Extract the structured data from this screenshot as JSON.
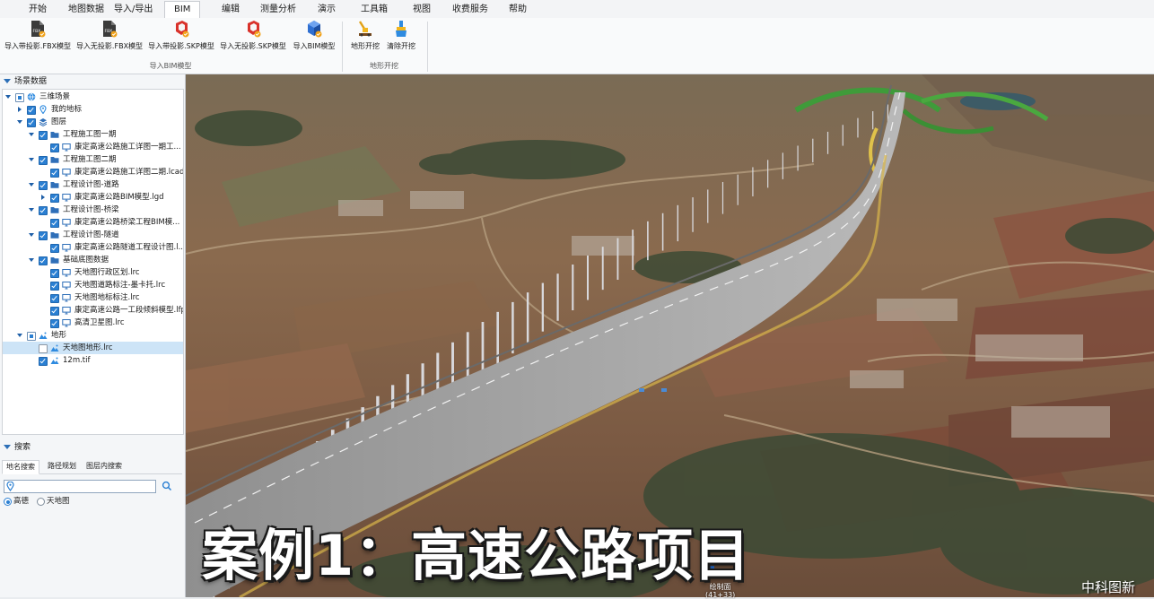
{
  "menu": {
    "items": [
      "开始",
      "地图数据",
      "导入/导出",
      "BIM",
      "编辑",
      "测量分析",
      "演示",
      "工具箱",
      "视图",
      "收费服务",
      "帮助"
    ],
    "active": "BIM"
  },
  "ribbon": {
    "bim_group_label": "导入BIM模型",
    "terrain_group_label": "地形开挖",
    "buttons": {
      "import_fbx_proj": "导入带投影.FBX模型",
      "import_fbx_noproj": "导入无投影.FBX模型",
      "import_skp_proj": "导入带投影.SKP模型",
      "import_skp_noproj": "导入无投影.SKP模型",
      "import_bim": "导入BIM模型",
      "terrain_dig": "地形开挖",
      "clear_dig": "清除开挖"
    },
    "icon_texts": {
      "fbx": "FBX"
    }
  },
  "scene_panel": {
    "title": "场景数据",
    "tree": [
      {
        "label": "三维场景",
        "depth": 0,
        "expanded": true,
        "check": "partial",
        "icon": "globe-icon"
      },
      {
        "label": "我的地标",
        "depth": 1,
        "expanded": false,
        "check": "on",
        "icon": "pin-icon"
      },
      {
        "label": "图层",
        "depth": 1,
        "expanded": true,
        "check": "on",
        "icon": "layers-icon"
      },
      {
        "label": "工程施工图一期",
        "depth": 2,
        "expanded": true,
        "check": "on",
        "icon": "folder-icon"
      },
      {
        "label": "康定高速公路施工详图一期工...",
        "depth": 3,
        "expanded": null,
        "check": "on",
        "icon": "monitor-icon"
      },
      {
        "label": "工程施工图二期",
        "depth": 2,
        "expanded": true,
        "check": "on",
        "icon": "folder-icon"
      },
      {
        "label": "康定高速公路施工详图二期.lcad",
        "depth": 3,
        "expanded": null,
        "check": "on",
        "icon": "monitor-icon"
      },
      {
        "label": "工程设计图-道路",
        "depth": 2,
        "expanded": true,
        "check": "on",
        "icon": "folder-icon"
      },
      {
        "label": "康定高速公路BIM模型.lgd",
        "depth": 3,
        "expanded": false,
        "check": "on",
        "icon": "monitor-icon"
      },
      {
        "label": "工程设计图-桥梁",
        "depth": 2,
        "expanded": true,
        "check": "on",
        "icon": "folder-icon"
      },
      {
        "label": "康定高速公路桥梁工程BIM模...",
        "depth": 3,
        "expanded": null,
        "check": "on",
        "icon": "monitor-icon"
      },
      {
        "label": "工程设计图-隧道",
        "depth": 2,
        "expanded": true,
        "check": "on",
        "icon": "folder-icon"
      },
      {
        "label": "康定高速公路隧道工程设计图.l...",
        "depth": 3,
        "expanded": null,
        "check": "on",
        "icon": "monitor-icon"
      },
      {
        "label": "基础底图数据",
        "depth": 2,
        "expanded": true,
        "check": "on",
        "icon": "folder-icon"
      },
      {
        "label": "天地图行政区划.lrc",
        "depth": 3,
        "expanded": null,
        "check": "on",
        "icon": "monitor-icon"
      },
      {
        "label": "天地图道路标注-墨卡托.lrc",
        "depth": 3,
        "expanded": null,
        "check": "on",
        "icon": "monitor-icon"
      },
      {
        "label": "天地图地标标注.lrc",
        "depth": 3,
        "expanded": null,
        "check": "on",
        "icon": "monitor-icon"
      },
      {
        "label": "康定高速公路一工段倾斜模型.lfp",
        "depth": 3,
        "expanded": null,
        "check": "on",
        "icon": "monitor-icon"
      },
      {
        "label": "高清卫星图.lrc",
        "depth": 3,
        "expanded": null,
        "check": "on",
        "icon": "monitor-icon"
      },
      {
        "label": "地形",
        "depth": 1,
        "expanded": true,
        "check": "partial",
        "icon": "terrain-icon"
      },
      {
        "label": "天地图地形.lrc",
        "depth": 2,
        "expanded": null,
        "check": "off",
        "icon": "terrain-icon",
        "selected": true
      },
      {
        "label": "12m.tif",
        "depth": 2,
        "expanded": null,
        "check": "on",
        "icon": "terrain-icon"
      }
    ]
  },
  "search_panel": {
    "title": "搜索",
    "tabs": [
      "地名搜索",
      "路径规划",
      "图层内搜索"
    ],
    "active_tab": "地名搜索",
    "input_value": "",
    "sources": [
      "高德",
      "天地图"
    ],
    "selected_source": "高德"
  },
  "view": {
    "overlay_title": "案例1：高速公路项目",
    "watermark": "中科图新",
    "map_label_line1": "绘制面",
    "map_label_line2": "(41+33)"
  },
  "colors": {
    "accent": "#2a7fd2",
    "folder": "#2f6fb8",
    "selected_row": "#cde4f7"
  }
}
